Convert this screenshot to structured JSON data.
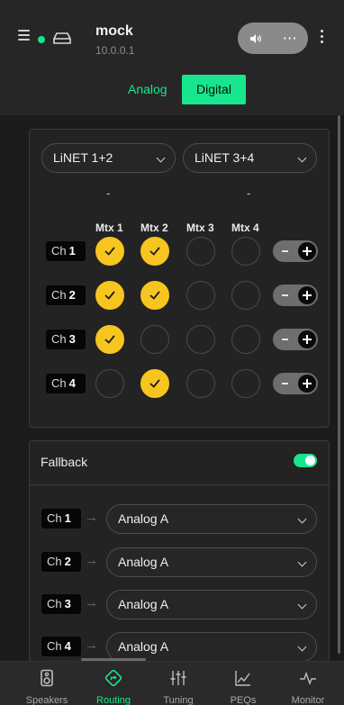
{
  "header": {
    "device_name": "mock",
    "device_ip": "10.0.0.1",
    "more_label": "···"
  },
  "mode_tabs": {
    "analog": "Analog",
    "digital": "Digital",
    "active": "Digital"
  },
  "matrix": {
    "inputs": [
      "LiNET 1+2",
      "LiNET 3+4"
    ],
    "input_sub": [
      "-",
      "-"
    ],
    "columns": [
      "Mtx 1",
      "Mtx 2",
      "Mtx 3",
      "Mtx 4"
    ],
    "rows": [
      {
        "prefix": "Ch",
        "num": "1",
        "checked": [
          true,
          true,
          false,
          false
        ]
      },
      {
        "prefix": "Ch",
        "num": "2",
        "checked": [
          true,
          true,
          false,
          false
        ]
      },
      {
        "prefix": "Ch",
        "num": "3",
        "checked": [
          true,
          false,
          false,
          false
        ]
      },
      {
        "prefix": "Ch",
        "num": "4",
        "checked": [
          false,
          true,
          false,
          false
        ]
      }
    ]
  },
  "fallback": {
    "title": "Fallback",
    "enabled": true,
    "rows": [
      {
        "prefix": "Ch",
        "num": "1",
        "arrow": "→",
        "source": "Analog A"
      },
      {
        "prefix": "Ch",
        "num": "2",
        "arrow": "→",
        "source": "Analog A"
      },
      {
        "prefix": "Ch",
        "num": "3",
        "arrow": "→",
        "source": "Analog A"
      },
      {
        "prefix": "Ch",
        "num": "4",
        "arrow": "→",
        "source": "Analog A"
      }
    ]
  },
  "nav": {
    "items": [
      {
        "label": "Speakers",
        "icon": "speaker-icon"
      },
      {
        "label": "Routing",
        "icon": "routing-icon"
      },
      {
        "label": "Tuning",
        "icon": "sliders-icon"
      },
      {
        "label": "PEQs",
        "icon": "graph-icon"
      },
      {
        "label": "Monitor",
        "icon": "pulse-icon"
      }
    ],
    "active": "Routing"
  },
  "colors": {
    "accent": "#18e68e",
    "check": "#f7c51f",
    "background": "#1b1b1b"
  }
}
